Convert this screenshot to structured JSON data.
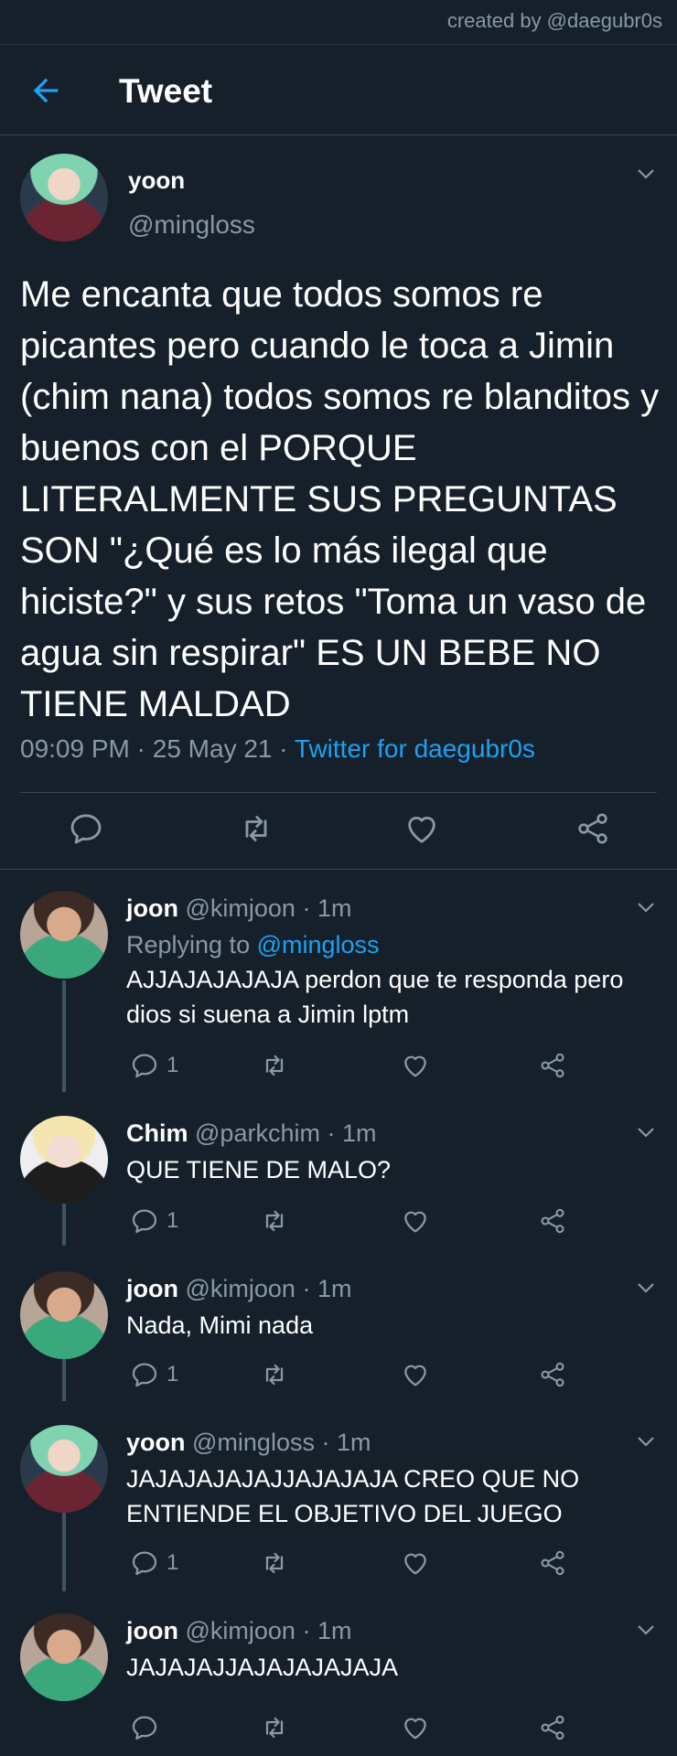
{
  "credit": "created by @daegubr0s",
  "header": {
    "title": "Tweet",
    "back_icon": "arrow-left-icon",
    "accent": "#1da1f2"
  },
  "main_tweet": {
    "name": "yoon",
    "handle": "@mingloss",
    "text": "Me encanta que todos somos re picantes pero cuando le toca a Jimin (chim nana) todos somos re blanditos y buenos con el PORQUE LITERALMENTE SUS PREGUNTAS SON  \"¿Qué es lo más ilegal que hiciste?\" y sus retos \"Toma un vaso de agua sin respirar\" ES UN BEBE NO TIENE MALDAD",
    "time": "09:09 PM",
    "date": "25 May 21",
    "source": "Twitter for daegubr0s",
    "sep1": " · ",
    "sep2": " · "
  },
  "replies": [
    {
      "name": "joon",
      "handle": "@kimjoon",
      "time": "1m",
      "replying_prefix": "Replying to ",
      "replying_to": "@mingloss",
      "text": "AJJAJAJAJAJA perdon que te responda pero dios si suena a Jimin lptm",
      "reply_count": "1",
      "sep": " · "
    },
    {
      "name": "Chim",
      "handle": "@parkchim",
      "time": "1m",
      "text": "QUE TIENE DE MALO?",
      "reply_count": "1",
      "sep": " · "
    },
    {
      "name": "joon",
      "handle": "@kimjoon",
      "time": "1m",
      "text": "Nada, Mimi nada",
      "reply_count": "1",
      "sep": " · "
    },
    {
      "name": "yoon",
      "handle": "@mingloss",
      "time": "1m",
      "text": "JAJAJAJAJAJJAJAJAJA CREO QUE NO ENTIENDE EL OBJETIVO DEL JUEGO",
      "reply_count": "1",
      "sep": " · "
    },
    {
      "name": "joon",
      "handle": "@kimjoon",
      "time": "1m",
      "text": "JAJAJAJJAJAJAJAJAJA",
      "reply_count": "",
      "sep": " · "
    }
  ]
}
